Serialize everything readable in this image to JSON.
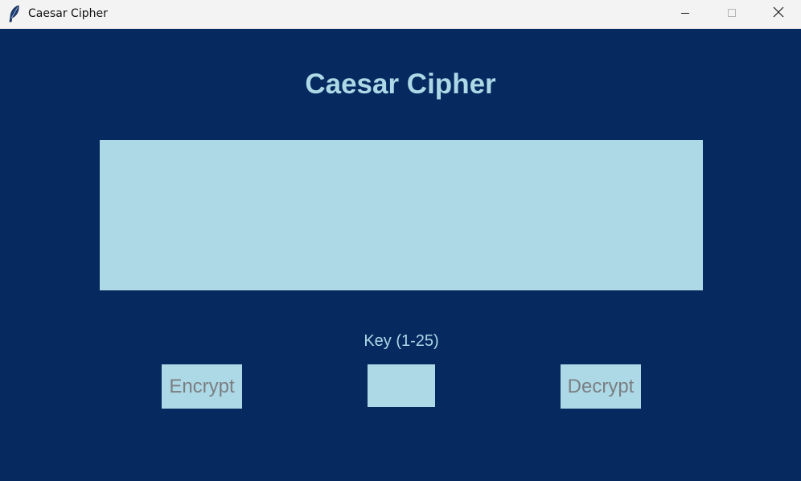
{
  "window": {
    "title": "Caesar Cipher",
    "icon": "feather-icon",
    "controls": [
      "minimize-icon",
      "maximize-icon",
      "close-icon"
    ]
  },
  "app": {
    "heading": "Caesar Cipher",
    "message_value": "",
    "key_label": "Key (1-25)",
    "key_value": "",
    "encrypt_label": "Encrypt",
    "decrypt_label": "Decrypt"
  },
  "colors": {
    "background": "#062960",
    "accent": "#add8e6",
    "button_text": "#7a7f82",
    "titlebar": "#f3f3f3"
  }
}
